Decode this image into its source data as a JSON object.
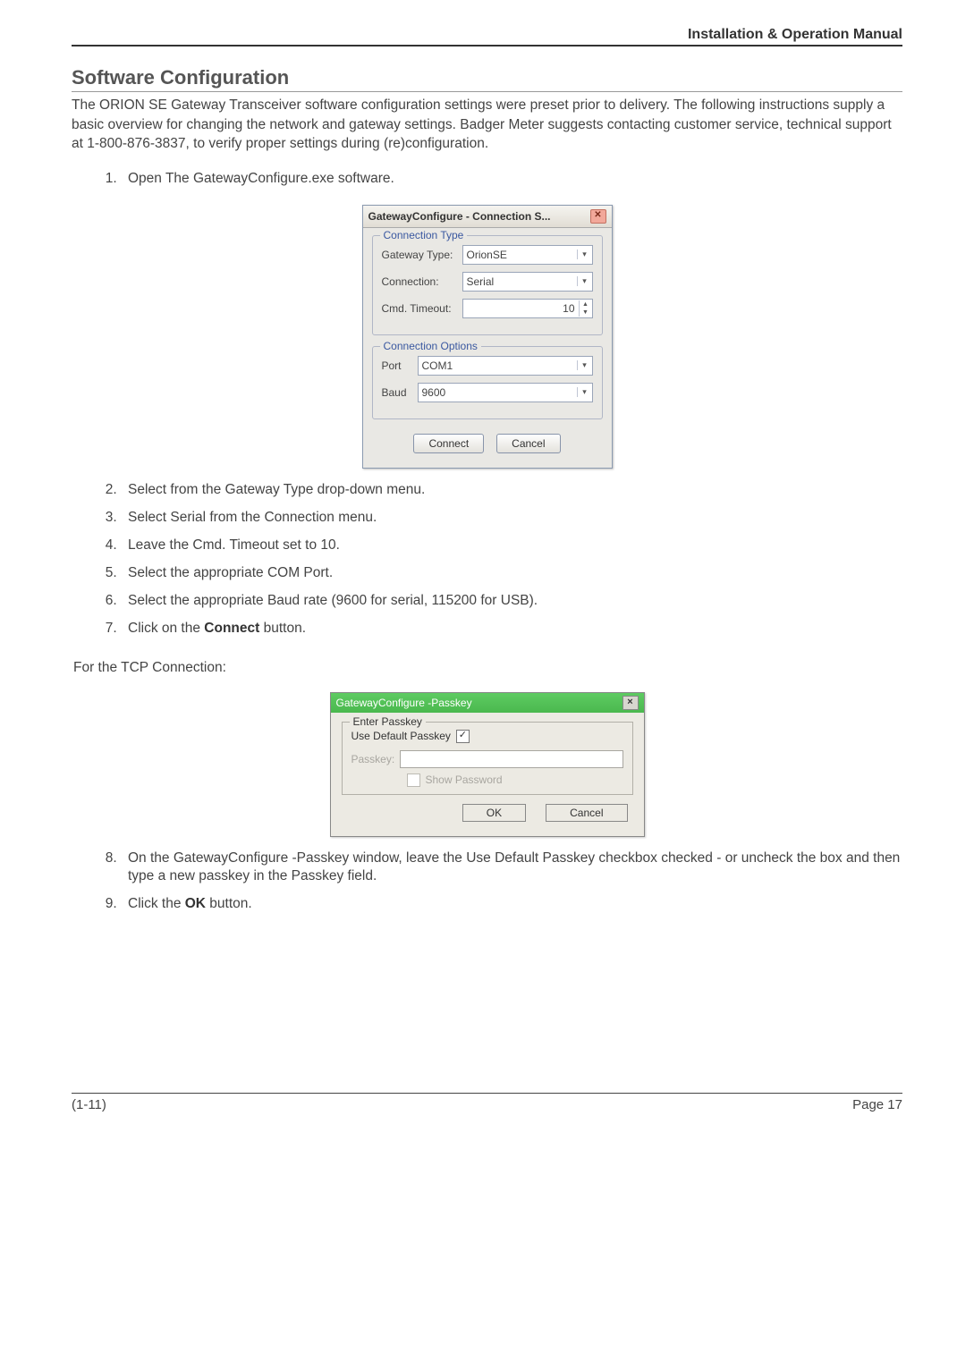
{
  "header": {
    "manual_title": "Installation & Operation Manual"
  },
  "section": {
    "title": "Software Configuration",
    "intro": "The ORION SE Gateway Transceiver software configuration settings were preset prior to delivery. The following instructions supply a basic overview for changing the network and gateway settings. Badger Meter suggests contacting customer service, technical support at 1-800-876-3837, to verify proper settings during (re)configuration."
  },
  "steps_a": [
    "Open The GatewayConfigure.exe software."
  ],
  "dialog1": {
    "title": "GatewayConfigure - Connection S...",
    "group1_legend": "Connection Type",
    "gateway_type_label": "Gateway Type:",
    "gateway_type_value": "OrionSE",
    "connection_label": "Connection:",
    "connection_value": "Serial",
    "cmd_timeout_label": "Cmd. Timeout:",
    "cmd_timeout_value": "10",
    "group2_legend": "Connection Options",
    "port_label": "Port",
    "port_value": "COM1",
    "baud_label": "Baud",
    "baud_value": "9600",
    "connect_btn": "Connect",
    "cancel_btn": "Cancel"
  },
  "steps_b": [
    "Select  from the Gateway Type drop-down menu.",
    "Select Serial from the Connection menu.",
    "Leave the Cmd. Timeout set to 10.",
    "Select the appropriate COM Port.",
    "Select the appropriate Baud rate (9600 for serial, 115200 for USB).",
    "Click on the Connect button."
  ],
  "step7_prefix": "Click on the ",
  "step7_bold": "Connect",
  "step7_suffix": " button.",
  "subhead": "For the TCP Connection:",
  "dialog2": {
    "title": "GatewayConfigure -Passkey",
    "group_legend": "Enter Passkey",
    "use_default_label": "Use Default Passkey",
    "passkey_label": "Passkey:",
    "show_password_label": "Show Password",
    "ok_btn": "OK",
    "cancel_btn": "Cancel"
  },
  "steps_c_8": "On the GatewayConfigure -Passkey window, leave the Use Default Passkey checkbox checked - or uncheck the box and then type a new passkey in the Passkey field.",
  "step9_prefix": "Click the ",
  "step9_bold": "OK",
  "step9_suffix": " button.",
  "footer": {
    "left": "(1-11)",
    "right": "Page 17"
  }
}
